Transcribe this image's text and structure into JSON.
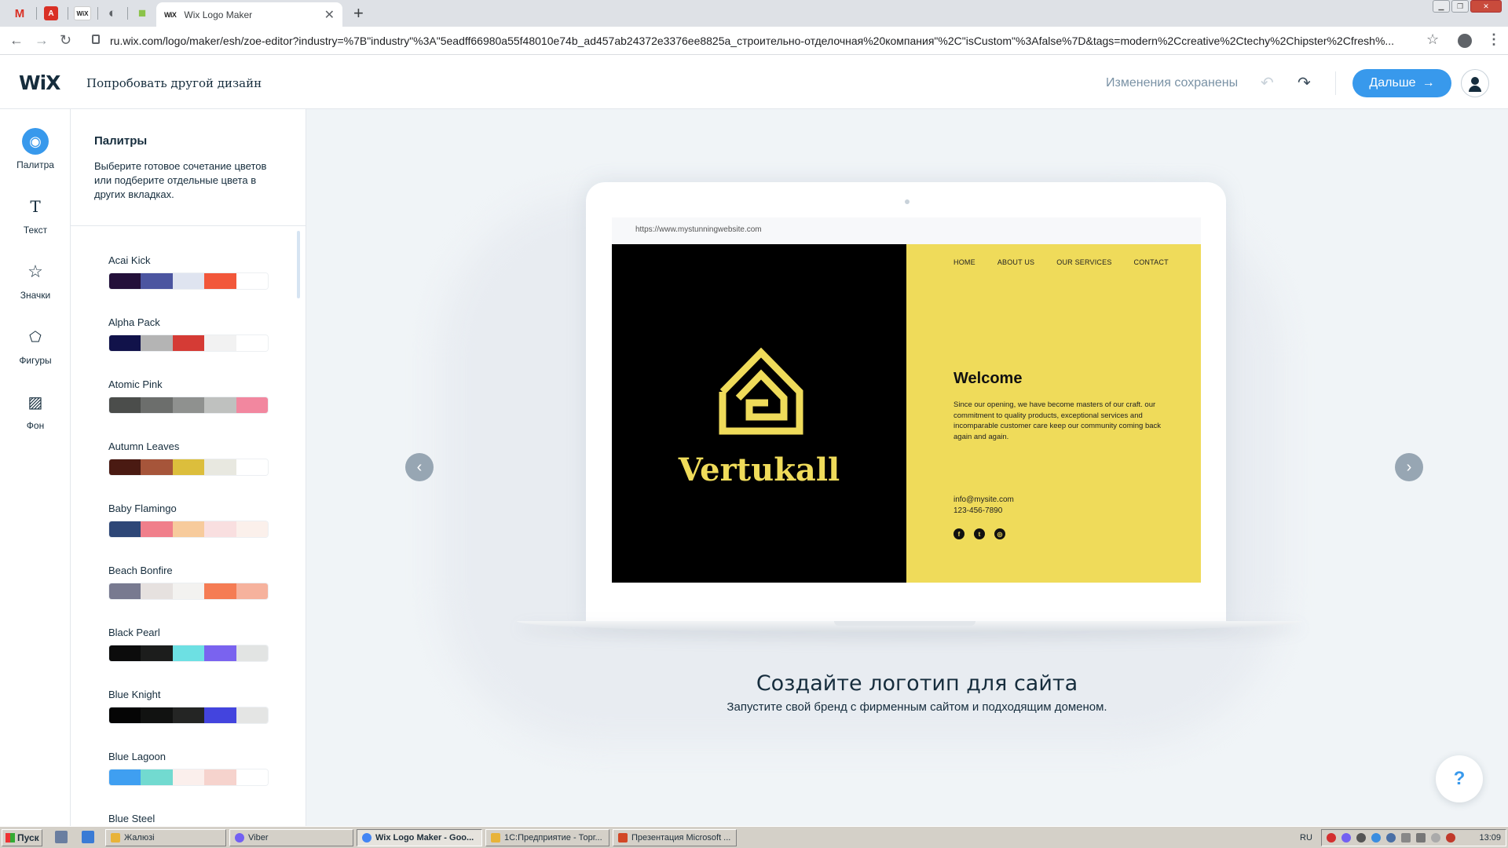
{
  "browser": {
    "pinned_tabs": [
      {
        "icon": "gmail-icon",
        "glyph": "M",
        "color": "#d93025"
      },
      {
        "icon": "pdf-icon",
        "glyph": "A",
        "color": "#d93025"
      },
      {
        "icon": "wix-icon",
        "glyph": "WiX",
        "color": "#222222"
      },
      {
        "icon": "globe-icon",
        "glyph": "◐",
        "color": "#5f6368"
      },
      {
        "icon": "shop-icon",
        "glyph": "■",
        "color": "#8bc34a"
      }
    ],
    "active_tab": {
      "favicon": "WiX",
      "title": "Wix Logo Maker"
    },
    "url": "ru.wix.com/logo/maker/esh/zoe-editor?industry=%7B\"industry\"%3A\"5eadff66980a55f48010e74b_ad457ab24372e3376ee8825a_строительно-отделочная%20компания\"%2C\"isCustom\"%3Afalse%7D&tags=modern%2Ccreative%2Ctechy%2Chipster%2Cfresh%..."
  },
  "header": {
    "logo": "WiX",
    "try_other": "Попробовать другой дизайн",
    "saved_status": "Изменения сохранены",
    "next_label": "Дальше",
    "accent": "#3899ec"
  },
  "rail": {
    "items": [
      {
        "label": "Палитра",
        "icon": "palette-icon",
        "glyph": "◉",
        "active": true
      },
      {
        "label": "Текст",
        "icon": "text-icon",
        "glyph": "T",
        "active": false
      },
      {
        "label": "Значки",
        "icon": "star-icon",
        "glyph": "☆",
        "active": false
      },
      {
        "label": "Фигуры",
        "icon": "shapes-icon",
        "glyph": "⬠",
        "active": false
      },
      {
        "label": "Фон",
        "icon": "background-icon",
        "glyph": "▨",
        "active": false
      }
    ]
  },
  "panel": {
    "title": "Палитры",
    "description": "Выберите готовое сочетание цветов или подберите отдельные цвета в других вкладках.",
    "palettes": [
      {
        "name": "Acai Kick",
        "colors": [
          "#23103a",
          "#4b55a0",
          "#dfe4f0",
          "#f2573a",
          "#ffffff"
        ]
      },
      {
        "name": "Alpha Pack",
        "colors": [
          "#11124a",
          "#b4b4b4",
          "#d53b35",
          "#f2f2f2",
          "#ffffff"
        ]
      },
      {
        "name": "Atomic Pink",
        "colors": [
          "#4b4d4b",
          "#6c6e6c",
          "#8f918f",
          "#bfc1bf",
          "#f2879f"
        ]
      },
      {
        "name": "Autumn Leaves",
        "colors": [
          "#4a1a12",
          "#a6553a",
          "#dcbe3c",
          "#e8e8e0",
          "#ffffff"
        ]
      },
      {
        "name": "Baby Flamingo",
        "colors": [
          "#2e4777",
          "#f07f8b",
          "#f7cb9c",
          "#f9dfe0",
          "#fbf0eb"
        ]
      },
      {
        "name": "Beach Bonfire",
        "colors": [
          "#787a90",
          "#e6e1df",
          "#f3f2f0",
          "#f57c54",
          "#f6b29d"
        ]
      },
      {
        "name": "Black Pearl",
        "colors": [
          "#0c0c0c",
          "#1c1d1c",
          "#6de0e3",
          "#7a63ef",
          "#e2e4e3"
        ]
      },
      {
        "name": "Blue Knight",
        "colors": [
          "#050505",
          "#111211",
          "#242524",
          "#4344de",
          "#e4e5e4"
        ]
      },
      {
        "name": "Blue Lagoon",
        "colors": [
          "#3f9ff1",
          "#72dad0",
          "#fbefec",
          "#f6d3cd",
          "#ffffff"
        ]
      },
      {
        "name": "Blue Steel",
        "colors": [
          "#23334a",
          "#52647c",
          "#8b9bb1",
          "#cfd7e1",
          "#ffffff"
        ]
      }
    ]
  },
  "preview": {
    "site_url": "https://www.mystunningwebsite.com",
    "brand_name": "Vertukall",
    "nav": [
      "HOME",
      "ABOUT US",
      "OUR SERVICES",
      "CONTACT"
    ],
    "welcome": "Welcome",
    "body": "Since our opening, we have become masters of our craft. our commitment to quality products, exceptional services and incomparable customer care keep our community coming back again and again.",
    "email": "info@mysite.com",
    "phone": "123-456-7890",
    "brand_color": "#efdb5a",
    "headline": "Создайте логотип для сайта",
    "subline": "Запустите свой бренд с фирменным сайтом и подходящим доменом.",
    "help_glyph": "?"
  },
  "taskbar": {
    "start_label": "Пуск",
    "tasks": [
      {
        "label": "Жалюзі",
        "icon_color": "#e8b339",
        "active": false
      },
      {
        "label": "Viber",
        "icon_color": "#7360f2",
        "active": false
      },
      {
        "label": "Wix Logo Maker - Goo...",
        "icon_color": "#4285f4",
        "active": true
      },
      {
        "label": "1С:Предприятие - Торг...",
        "icon_color": "#e8b339",
        "active": false
      },
      {
        "label": "Презентация Microsoft ...",
        "icon_color": "#d24726",
        "active": false
      }
    ],
    "lang": "RU",
    "clock": "13:09"
  }
}
